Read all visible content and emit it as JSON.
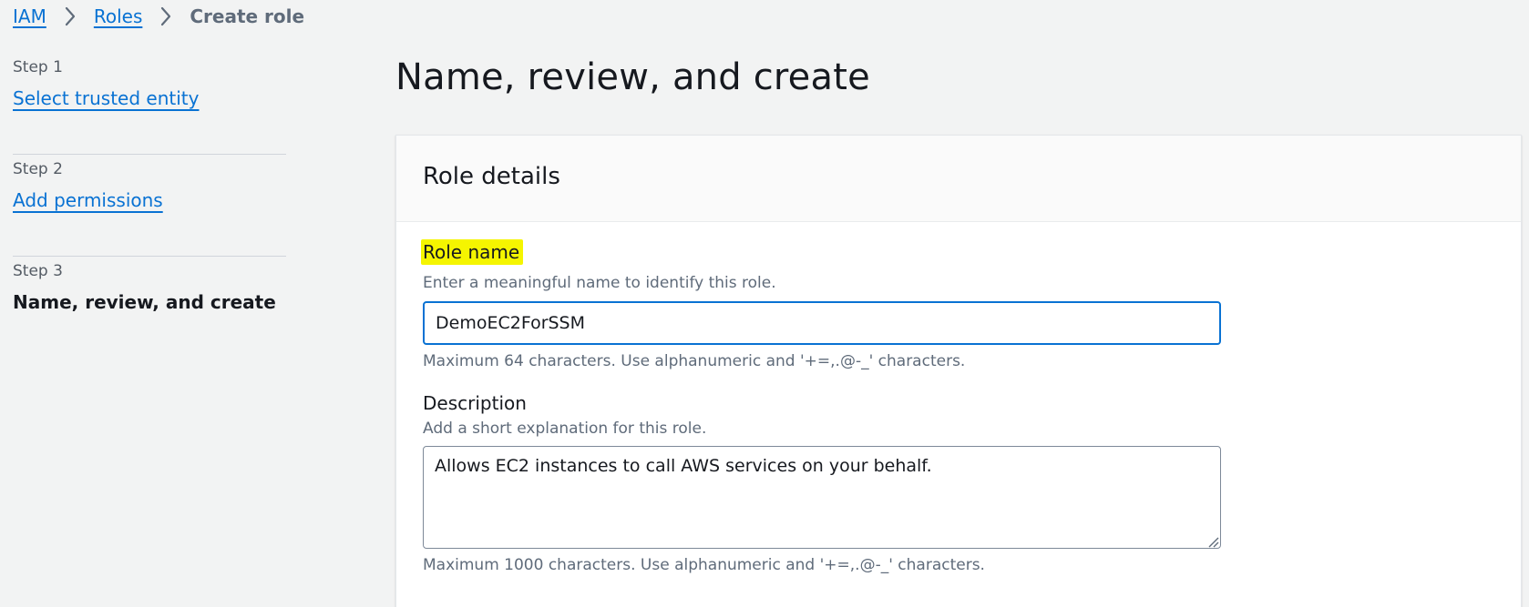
{
  "breadcrumb": {
    "items": [
      {
        "label": "IAM"
      },
      {
        "label": "Roles"
      },
      {
        "label": "Create role"
      }
    ]
  },
  "steps": [
    {
      "number": "Step 1",
      "title": "Select trusted entity"
    },
    {
      "number": "Step 2",
      "title": "Add permissions"
    },
    {
      "number": "Step 3",
      "title": "Name, review, and create"
    }
  ],
  "main": {
    "title": "Name, review, and create",
    "panel": {
      "title": "Role details",
      "role_name": {
        "label": "Role name",
        "description": "Enter a meaningful name to identify this role.",
        "value": "DemoEC2ForSSM",
        "constraint": "Maximum 64 characters. Use alphanumeric and '+=,.@-_' characters."
      },
      "description": {
        "label": "Description",
        "description": "Add a short explanation for this role.",
        "value": "Allows EC2 instances to call AWS services on your behalf.",
        "constraint": "Maximum 1000 characters. Use alphanumeric and '+=,.@-_' characters."
      }
    }
  },
  "colors": {
    "link": "#0972d3",
    "highlight": "#f5f500",
    "page_bg": "#f2f3f3",
    "focus_border": "#0972d3"
  },
  "icons": [
    "chevron-right-icon",
    "resize-handle-icon"
  ]
}
